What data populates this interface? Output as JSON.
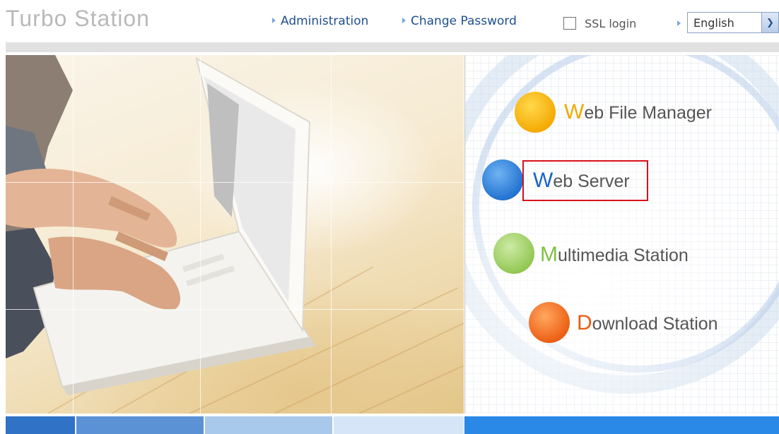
{
  "header": {
    "brand": "Turbo Station",
    "links": [
      "Administration",
      "Change Password"
    ],
    "ssl_label": "SSL login",
    "language": "English"
  },
  "menu": {
    "items": [
      {
        "initial": "W",
        "rest": "eb File Manager",
        "initial_color": "#f2a900",
        "orb_color": "#f7b800"
      },
      {
        "initial": "W",
        "rest": "eb Server",
        "initial_color": "#1a63c2",
        "orb_color": "#2f7fd6"
      },
      {
        "initial": "M",
        "rest": "ultimedia Station",
        "initial_color": "#7fc041",
        "orb_color": "#9ed060"
      },
      {
        "initial": "D",
        "rest": "ownload Station",
        "initial_color": "#ec5b10",
        "orb_color": "#f07020"
      }
    ]
  },
  "colors": {
    "highlight_border": "#d8101a",
    "footer": [
      "#2f72c6",
      "#5b92d6",
      "#a8c8ec",
      "#d6e6f8",
      "#2a88e6"
    ]
  }
}
